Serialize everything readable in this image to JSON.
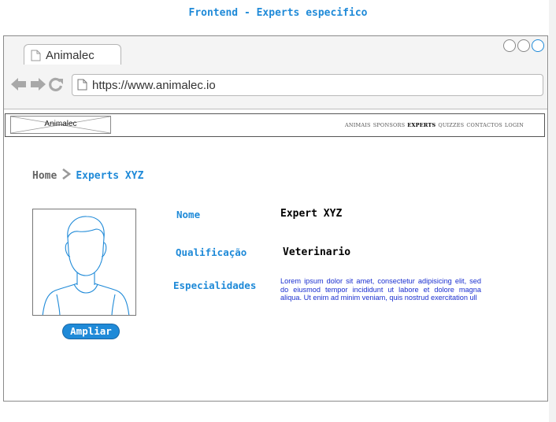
{
  "page_heading": "Frontend - Experts especifico",
  "browser": {
    "tab_label": "Animalec",
    "url": "https://www.animalec.io",
    "icons": [
      "back-arrow-icon",
      "forward-arrow-icon",
      "reload-icon",
      "page-icon"
    ]
  },
  "site": {
    "logo_text": "Animalec",
    "menu": [
      "ANIMAIS",
      "SPONSORS",
      "EXPERTS",
      "QUIZZES",
      "CONTACTOS",
      "LOGIN"
    ],
    "active_menu": "EXPERTS"
  },
  "breadcrumb": {
    "home": "Home",
    "separator_icon": "chevron-right-icon",
    "current": "Experts XYZ"
  },
  "expert": {
    "photo_icon": "person-avatar-icon",
    "ampliar_label": "Ampliar",
    "nome_label": "Nome",
    "nome_value": "Expert XYZ",
    "qualificacao_label": "Qualificação",
    "qualificacao_value": "Veterinario",
    "especialidades_label": "Especialidades",
    "especialidades_value": "Lorem ipsum dolor sit amet, consectetur adipisicing elit, sed do eiusmod tempor incididunt ut labore et dolore magna aliqua. Ut enim ad minim veniam, quis nostrud exercitation ull"
  },
  "colors": {
    "accent": "#1f8ad8",
    "description": "#1a2fd0",
    "frame": "#8a8a8a"
  }
}
